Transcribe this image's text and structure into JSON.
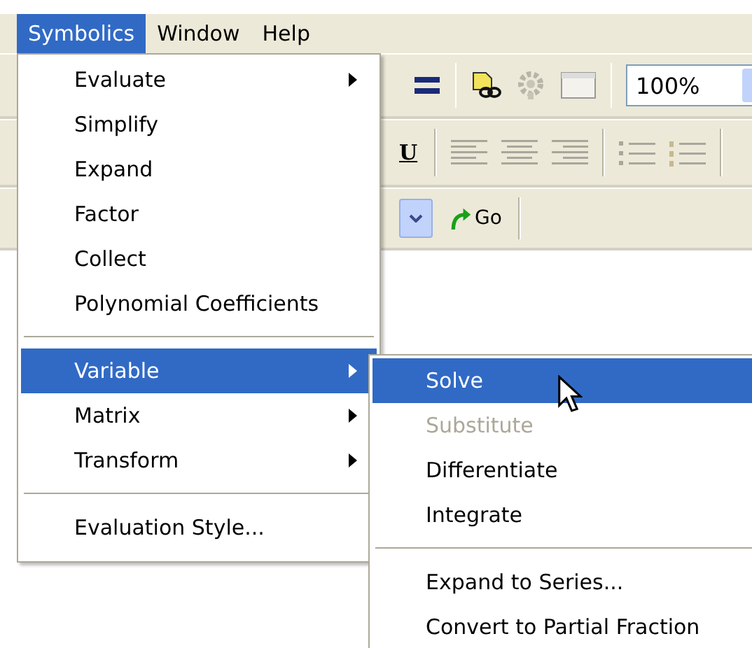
{
  "menubar": [
    {
      "label": "Symbolics",
      "selected": true
    },
    {
      "label": "Window",
      "selected": false
    },
    {
      "label": "Help",
      "selected": false
    }
  ],
  "toolbar": {
    "zoom": "100%",
    "underline_button": "U",
    "go_button": "Go"
  },
  "menu": {
    "items": [
      {
        "kind": "item",
        "label": "Evaluate",
        "submenu": true,
        "selected": false,
        "disabled": false
      },
      {
        "kind": "item",
        "label": "Simplify",
        "submenu": false,
        "selected": false,
        "disabled": false
      },
      {
        "kind": "item",
        "label": "Expand",
        "submenu": false,
        "selected": false,
        "disabled": false
      },
      {
        "kind": "item",
        "label": "Factor",
        "submenu": false,
        "selected": false,
        "disabled": false
      },
      {
        "kind": "item",
        "label": "Collect",
        "submenu": false,
        "selected": false,
        "disabled": false
      },
      {
        "kind": "item",
        "label": "Polynomial Coefficients",
        "submenu": false,
        "selected": false,
        "disabled": false
      },
      {
        "kind": "separator"
      },
      {
        "kind": "item",
        "label": "Variable",
        "submenu": true,
        "selected": true,
        "disabled": false
      },
      {
        "kind": "item",
        "label": "Matrix",
        "submenu": true,
        "selected": false,
        "disabled": false
      },
      {
        "kind": "item",
        "label": "Transform",
        "submenu": true,
        "selected": false,
        "disabled": false
      },
      {
        "kind": "separator"
      },
      {
        "kind": "item",
        "label": "Evaluation Style...",
        "submenu": false,
        "selected": false,
        "disabled": false
      }
    ]
  },
  "submenu": {
    "items": [
      {
        "kind": "item",
        "label": "Solve",
        "submenu": false,
        "selected": true,
        "disabled": false
      },
      {
        "kind": "item",
        "label": "Substitute",
        "submenu": false,
        "selected": false,
        "disabled": true
      },
      {
        "kind": "item",
        "label": "Differentiate",
        "submenu": false,
        "selected": false,
        "disabled": false
      },
      {
        "kind": "item",
        "label": "Integrate",
        "submenu": false,
        "selected": false,
        "disabled": false
      },
      {
        "kind": "separator"
      },
      {
        "kind": "item",
        "label": "Expand to Series...",
        "submenu": false,
        "selected": false,
        "disabled": false
      },
      {
        "kind": "item",
        "label": "Convert to Partial Fraction",
        "submenu": false,
        "selected": false,
        "disabled": false
      }
    ]
  }
}
